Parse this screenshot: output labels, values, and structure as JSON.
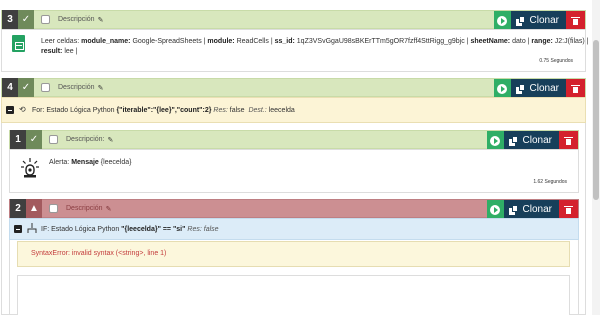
{
  "blocks": [
    {
      "number": "3",
      "description": "Descripción",
      "clone_label": "Clonar",
      "detail": {
        "prefix": "Leer celdas: ",
        "k1": "module_name:",
        "v1": " Google-SpreadSheets | ",
        "k2": "module:",
        "v2": " ReadCells | ",
        "k3": "ss_id:",
        "v3": " 1qZ3VSvGgaU98sBKErTTm5gOR7fzff4SttRigg_g9bjc | ",
        "k4": "sheetName:",
        "v4": " dato | ",
        "k5": "range:",
        "v5": " J2:J(filas) |",
        "k6": "result:",
        "v6": " lee |"
      },
      "time": "0.75 Segundos"
    },
    {
      "number": "4",
      "description": "Descripción",
      "clone_label": "Clonar",
      "for_label": "For: Estado Lógica Python",
      "for_expr": "{\"iterable\":\"{lee}\",\"count\":2}",
      "res_label": "Res:",
      "res_value": "false",
      "dest_label": "Dest.:",
      "dest_value": "leecelda"
    },
    {
      "number": "1",
      "description": "Descripción:",
      "clone_label": "Clonar",
      "alert_prefix": "Alerta: ",
      "alert_bold": "Mensaje",
      "alert_rest": " {leecelda}",
      "time": "1.62 Segundos"
    },
    {
      "number": "2",
      "description": "Descripción",
      "clone_label": "Clonar",
      "if_label": "IF: Estado Lógica Python",
      "if_expr": "\"{leecelda}\" == \"si\"",
      "res_label": "Res:",
      "res_value": "false",
      "error": "SyntaxError: invalid syntax (<string>, line 1)"
    }
  ],
  "colors": {
    "green_bar": "#d8e7bd",
    "red_bar": "#cc8f92",
    "play": "#2fae66",
    "clone": "#173f5a",
    "delete": "#d4212d",
    "for_panel": "#fcf4d6",
    "if_panel": "#dcecf8",
    "error_text": "#c33c3c"
  }
}
